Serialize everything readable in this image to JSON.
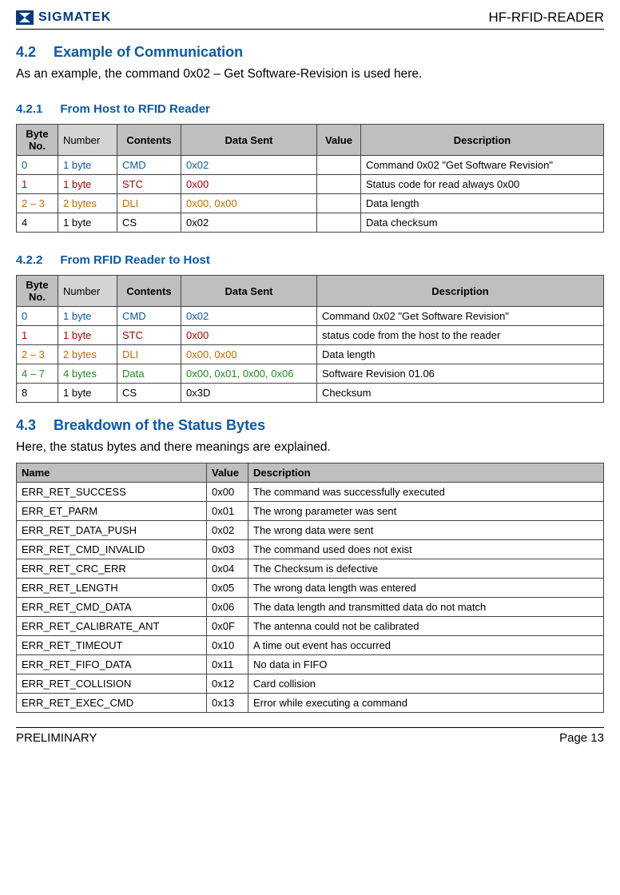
{
  "doc": {
    "brand": "SIGMATEK",
    "product": "HF-RFID-READER",
    "footer_left": "PRELIMINARY",
    "footer_right": "Page 13"
  },
  "s42": {
    "num": "4.2",
    "title": "Example of Communication",
    "para": "As an example, the command 0x02 – Get Software-Revision is used here."
  },
  "s421": {
    "num": "4.2.1",
    "title": "From Host to RFID Reader"
  },
  "s422": {
    "num": "4.2.2",
    "title": "From RFID Reader to Host"
  },
  "s43": {
    "num": "4.3",
    "title": "Breakdown of the Status Bytes",
    "para": "Here, the status bytes and there meanings are explained."
  },
  "t1_head": {
    "c0": "Byte No.",
    "c1": "Number",
    "c2": "Contents",
    "c3": "Data Sent",
    "c4": "Value",
    "c5": "Description"
  },
  "t1": {
    "r0": {
      "c0": "0",
      "c1": "1 byte",
      "c2": "CMD",
      "c3": "0x02",
      "c4": "",
      "c5": "Command 0x02 \"Get Software Revision\""
    },
    "r1": {
      "c0": "1",
      "c1": "1 byte",
      "c2": "STC",
      "c3": "0x00",
      "c4": "",
      "c5": "Status code for read always 0x00"
    },
    "r2": {
      "c0": "2 – 3",
      "c1": "2 bytes",
      "c2": "DLI",
      "c3": "0x00, 0x00",
      "c4": "",
      "c5": "Data length"
    },
    "r3": {
      "c0": "4",
      "c1": "1 byte",
      "c2": "CS",
      "c3": "0x02",
      "c4": "",
      "c5": "Data checksum"
    }
  },
  "t2_head": {
    "c0": "Byte No.",
    "c1": "Number",
    "c2": "Contents",
    "c3": "Data Sent",
    "c4": "Description"
  },
  "t2": {
    "r0": {
      "c0": "0",
      "c1": "1 byte",
      "c2": "CMD",
      "c3": "0x02",
      "c4": "Command 0x02 \"Get Software Revision\""
    },
    "r1": {
      "c0": "1",
      "c1": "1 byte",
      "c2": "STC",
      "c3": "0x00",
      "c4": "status code from the host to the reader"
    },
    "r2": {
      "c0": "2 – 3",
      "c1": "2 bytes",
      "c2": "DLI",
      "c3": "0x00, 0x00",
      "c4": "Data length"
    },
    "r3": {
      "c0": "4 – 7",
      "c1": "4 bytes",
      "c2": "Data",
      "c3": "0x00, 0x01, 0x00, 0x06",
      "c4": "Software Revision 01.06"
    },
    "r4": {
      "c0": "8",
      "c1": "1 byte",
      "c2": "CS",
      "c3": "0x3D",
      "c4": "Checksum"
    }
  },
  "t3_head": {
    "c0": "Name",
    "c1": "Value",
    "c2": "Description"
  },
  "t3": {
    "r0": {
      "c0": "ERR_RET_SUCCESS",
      "c1": "0x00",
      "c2": "The command was successfully executed"
    },
    "r1": {
      "c0": "ERR_ET_PARM",
      "c1": "0x01",
      "c2": "The wrong parameter was sent"
    },
    "r2": {
      "c0": "ERR_RET_DATA_PUSH",
      "c1": "0x02",
      "c2": "The wrong data were sent"
    },
    "r3": {
      "c0": "ERR_RET_CMD_INVALID",
      "c1": "0x03",
      "c2": "The command used does not exist"
    },
    "r4": {
      "c0": "ERR_RET_CRC_ERR",
      "c1": "0x04",
      "c2": "The Checksum is defective"
    },
    "r5": {
      "c0": "ERR_RET_LENGTH",
      "c1": "0x05",
      "c2": "The wrong data length was entered"
    },
    "r6": {
      "c0": "ERR_RET_CMD_DATA",
      "c1": "0x06",
      "c2": "The data length and transmitted data do not match"
    },
    "r7": {
      "c0": "ERR_RET_CALIBRATE_ANT",
      "c1": "0x0F",
      "c2": "The antenna could not be calibrated"
    },
    "r8": {
      "c0": "ERR_RET_TIMEOUT",
      "c1": "0x10",
      "c2": "A time out event has occurred"
    },
    "r9": {
      "c0": "ERR_RET_FIFO_DATA",
      "c1": "0x11",
      "c2": "No data in FIFO"
    },
    "r10": {
      "c0": "ERR_RET_COLLISION",
      "c1": "0x12",
      "c2": "Card collision"
    },
    "r11": {
      "c0": "ERR_RET_EXEC_CMD",
      "c1": "0x13",
      "c2": "Error while executing a command"
    }
  }
}
